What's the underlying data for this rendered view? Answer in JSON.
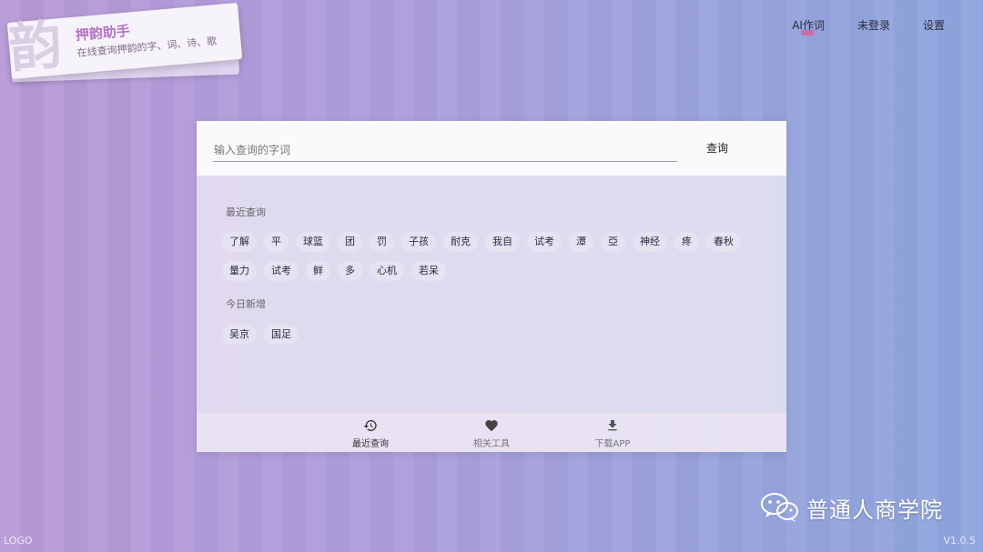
{
  "app": {
    "logo_glyph": "韵",
    "title": "押韵助手",
    "subtitle": "在线查询押韵的字、词、诗、歌"
  },
  "nav": {
    "ai": "AI作词",
    "login": "未登录",
    "settings": "设置"
  },
  "search": {
    "placeholder": "输入查询的字词",
    "button": "查询"
  },
  "recent": {
    "label": "最近查询",
    "items": [
      "了解",
      "平",
      "球篮",
      "团",
      "罚",
      "子孩",
      "耐克",
      "我自",
      "试考",
      "潭",
      "亞",
      "神经",
      "疼",
      "春秋",
      "量力",
      "试考",
      "鲜",
      "多",
      "心机",
      "若呆"
    ]
  },
  "today": {
    "label": "今日新增",
    "items": [
      "吴京",
      "国足"
    ]
  },
  "tabs": [
    {
      "label": "最近查询",
      "icon": "history-icon"
    },
    {
      "label": "相关工具",
      "icon": "heart-icon"
    },
    {
      "label": "下载APP",
      "icon": "download-icon"
    }
  ],
  "watermark": "普通人商学院",
  "footer": {
    "left": "LOGO",
    "right": "V1.0.5"
  },
  "colors": {
    "accent": "#b573c9",
    "badge": "#e05fa0"
  }
}
